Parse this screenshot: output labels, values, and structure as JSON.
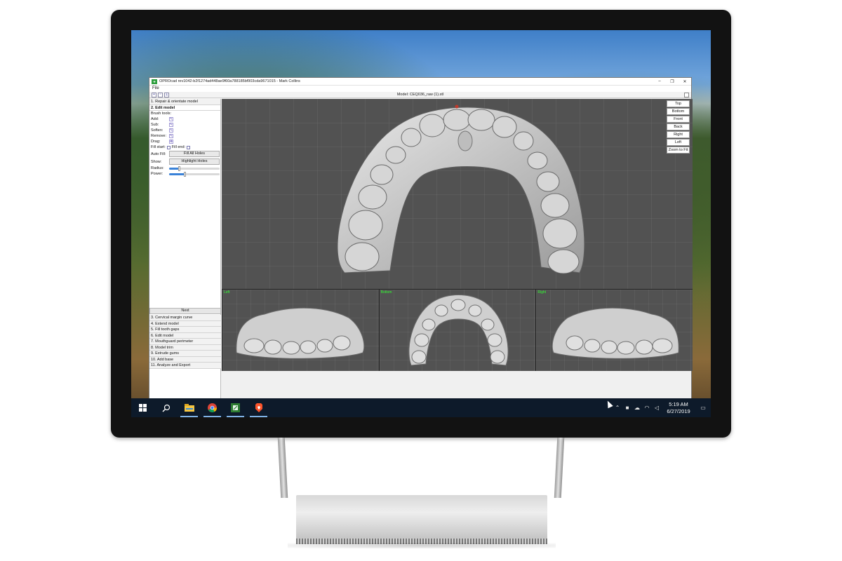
{
  "window": {
    "title": "OPROcad rev1042-b2f1274ad448ae9f60a788185bf903cda9671015 - Mark Collins",
    "app_icon": "app-logo-icon",
    "controls": [
      "–",
      "❐",
      "✕"
    ]
  },
  "menu": {
    "file": "File"
  },
  "toolbar": {
    "model_label": "Model: CEQ036_raw (1).stl"
  },
  "sidebar": {
    "steps_top": [
      "1. Repair & orientate model",
      "2. Edit model"
    ],
    "active_hint": "(step)",
    "brush_tools_label": "Brush tools:",
    "tools": [
      {
        "label": "Add:",
        "icon": "brush-add-icon"
      },
      {
        "label": "Sub:",
        "icon": "brush-sub-icon"
      },
      {
        "label": "Soften:",
        "icon": "brush-soften-icon"
      },
      {
        "label": "Remove:",
        "icon": "brush-remove-icon"
      },
      {
        "label": "Drag:",
        "icon": "brush-drag-icon"
      }
    ],
    "fill_start_label": "Fill start:",
    "fill_end_label": "Fill end:",
    "auto_fill_label": "Auto Fill:",
    "fill_all_holes": "Fill All Holes",
    "show_label": "Show:",
    "highlight_holes": "Highlight Holes",
    "radius_label": "Radius:",
    "radius_value": 0.2,
    "power_label": "Power:",
    "power_value": 0.3,
    "next": "Next",
    "steps_bottom": [
      "3. Cervical margin curve",
      "4. Extend model",
      "5. Fill tooth gaps",
      "6. Edit model",
      "7. Mouthguard perimeter",
      "8. Model trim",
      "9. Extrude gums",
      "10. Add base",
      "11. Analyze and Export"
    ]
  },
  "view_buttons": [
    "Top",
    "Bottom",
    "Front",
    "Back",
    "Right",
    "Left",
    "Zoom to Fit"
  ],
  "sub_views": [
    "Left",
    "Bottom",
    "Right"
  ],
  "taskbar": {
    "time": "5:19 AM",
    "date": "6/27/2019",
    "apps": [
      "start-icon",
      "search-icon",
      "file-explorer-icon",
      "chrome-icon",
      "oprocad-icon",
      "brave-icon"
    ]
  },
  "colors": {
    "viewport_bg": "#525252",
    "taskbar_bg": "#0d1a2a",
    "view_label": "#33ff33",
    "accent": "#3a82d8"
  }
}
